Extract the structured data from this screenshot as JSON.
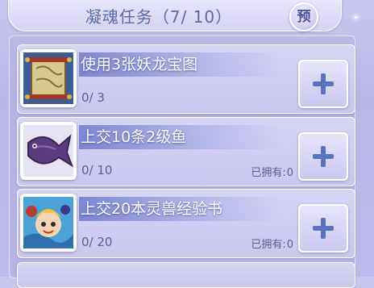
{
  "header": {
    "title": "凝魂任务（7/ 10）",
    "preview_label": "预"
  },
  "tasks": [
    {
      "icon": "treasure-map-scroll-icon",
      "name": "使用3张妖龙宝图",
      "progress": "0/ 3",
      "owned_label": "",
      "owned_value": ""
    },
    {
      "icon": "purple-fish-icon",
      "name": "上交10条2级鱼",
      "progress": "0/ 10",
      "owned_label": "已拥有:",
      "owned_value": "0"
    },
    {
      "icon": "spirit-beast-book-icon",
      "name": "上交20本灵兽经验书",
      "progress": "0/ 20",
      "owned_label": "已拥有:",
      "owned_value": "0"
    }
  ],
  "colors": {
    "accent": "#5a71bd",
    "title_text": "#5d6aa8",
    "background": "#bdb9ea"
  }
}
